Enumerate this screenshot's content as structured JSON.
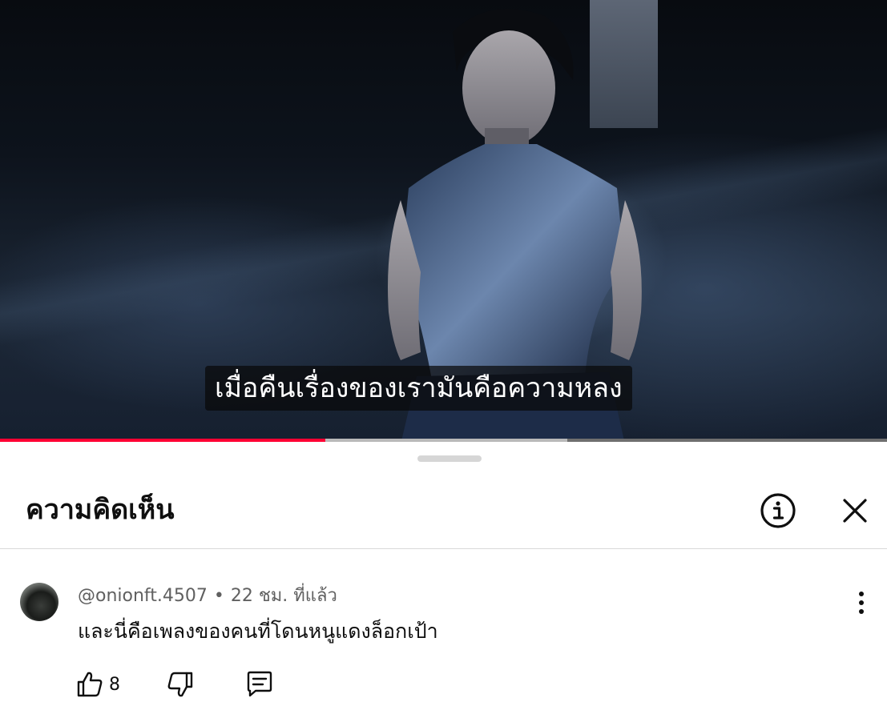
{
  "video": {
    "subtitle": "เมื่อคืนเรื่องของเรามันคือความหลง",
    "progress_fraction": 0.367,
    "buffered_fraction": 0.64
  },
  "comments_panel": {
    "title": "ความคิดเห็น",
    "info_icon": "info-circle-icon",
    "close_icon": "close-icon"
  },
  "comment": {
    "author": "@onionft.4507",
    "separator": "•",
    "time": "22 ชม. ที่แล้ว",
    "text": "และนี่คือเพลงของคนที่โดนหนูแดงล็อกเป้า",
    "like_count": "8",
    "icons": [
      "thumbs-up-icon",
      "thumbs-down-icon",
      "reply-icon",
      "more-vertical-icon"
    ]
  },
  "colors": {
    "accent": "#ff0033",
    "text_primary": "#0f0f0f",
    "text_secondary": "#606060"
  }
}
